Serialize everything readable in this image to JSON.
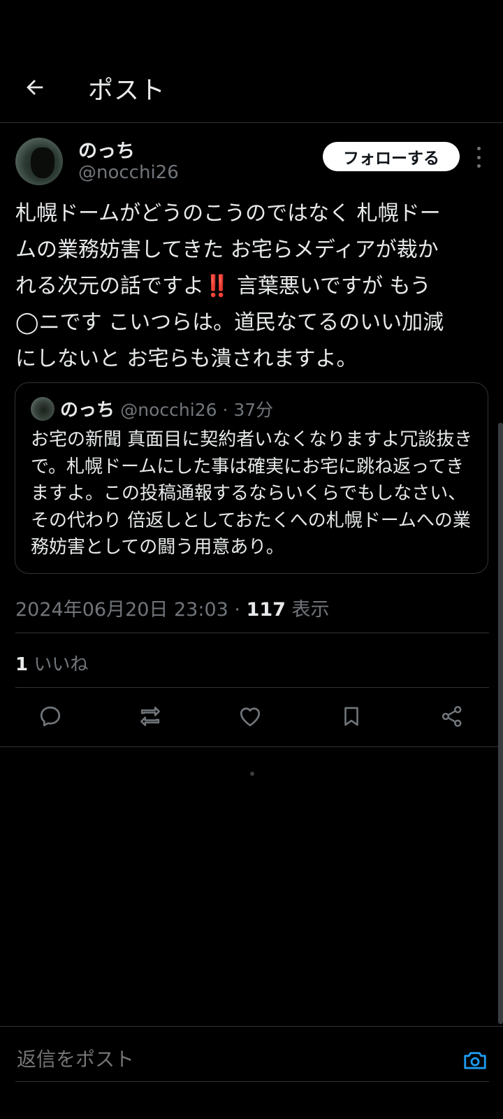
{
  "header": {
    "title": "ポスト"
  },
  "author": {
    "name": "のっち",
    "handle": "@nocchi26",
    "follow_label": "フォローする"
  },
  "post": {
    "text_lines": [
      "札幌ドームがどうのこうのではなく 札幌ドー",
      "ムの業務妨害してきた お宅らメディアが裁か",
      "れる次元の話ですよ",
      " 言葉悪いですが もう",
      "◯ニです こいつらは。道民なてるのいい加減",
      "にしないと お宅らも潰されますよ。"
    ],
    "emoji": "‼️"
  },
  "quote": {
    "name": "のっち",
    "meta": "@nocchi26 · 37分",
    "text": "お宅の新聞 真面目に契約者いなくなりますよ冗談抜きで。札幌ドームにした事は確実にお宅に跳ね返ってきますよ。この投稿通報するならいくらでもしなさい、その代わり 倍返しとしておたくへの札幌ドームへの業務妨害としての闘う用意あり。"
  },
  "stats": {
    "timestamp": "2024年06月20日 23:03 · ",
    "views": "117",
    "views_label": " 表示",
    "likes": "1",
    "likes_label": " いいね"
  },
  "reply": {
    "placeholder": "返信をポスト"
  },
  "colors": {
    "background": "#000000",
    "text": "#e7e9ea",
    "muted": "#71767b",
    "accent": "#1d9bf0",
    "divider": "#2f3336"
  },
  "icons": [
    "back-arrow-icon",
    "more-vertical-icon",
    "reply-icon",
    "repost-icon",
    "like-icon",
    "bookmark-icon",
    "share-icon",
    "camera-icon"
  ]
}
